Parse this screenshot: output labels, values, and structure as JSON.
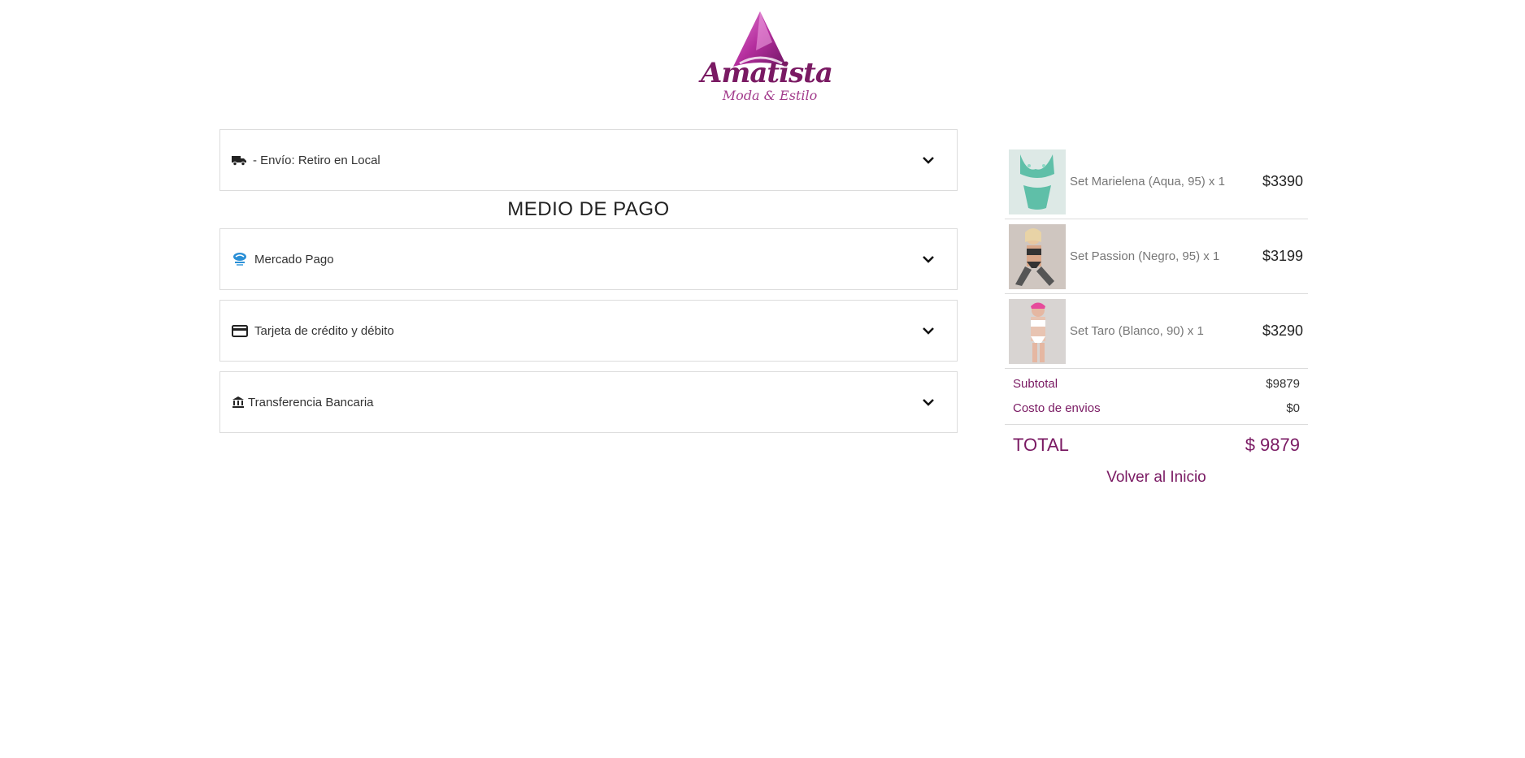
{
  "brand": {
    "name": "Amatista",
    "tagline": "Moda & Estilo",
    "accent_color": "#7a1a63"
  },
  "shipping": {
    "label": "- Envío: Retiro en Local",
    "icon": "truck-icon"
  },
  "payment": {
    "section_title": "MEDIO DE PAGO",
    "methods": [
      {
        "label": "Mercado Pago",
        "icon": "mercado-pago-icon"
      },
      {
        "label": "Tarjeta de crédito y débito",
        "icon": "credit-card-icon"
      },
      {
        "label": "Transferencia Bancaria",
        "icon": "bank-icon"
      }
    ]
  },
  "cart": {
    "items": [
      {
        "name": "Set Marielena (Aqua, 95) x 1",
        "price": "$3390"
      },
      {
        "name": "Set Passion (Negro, 95) x 1",
        "price": "$3199"
      },
      {
        "name": "Set Taro (Blanco, 90) x 1",
        "price": "$3290"
      }
    ],
    "subtotal_label": "Subtotal",
    "subtotal_value": "$9879",
    "shipping_cost_label": "Costo de envios",
    "shipping_cost_value": "$0",
    "total_label": "TOTAL",
    "total_value": "$ 9879",
    "back_link": "Volver al Inicio"
  }
}
